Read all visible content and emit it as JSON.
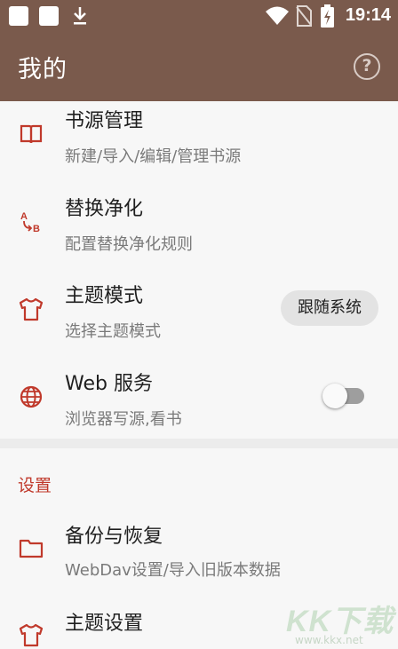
{
  "status_bar": {
    "time": "19:14",
    "icons": [
      "square-icon",
      "square-icon",
      "download-icon",
      "wifi-icon",
      "no-sim-icon",
      "battery-charging-icon"
    ]
  },
  "app_bar": {
    "title": "我的",
    "help_icon": "?"
  },
  "items": [
    {
      "title": "书源管理",
      "subtitle": "新建/导入/编辑/管理书源",
      "icon": "book-icon"
    },
    {
      "title": "替换净化",
      "subtitle": "配置替换净化规则",
      "icon": "replace-ab-icon"
    },
    {
      "title": "主题模式",
      "subtitle": "选择主题模式",
      "icon": "shirt-icon",
      "value": "跟随系统"
    },
    {
      "title": "Web 服务",
      "subtitle": "浏览器写源,看书",
      "icon": "globe-icon",
      "toggle": false
    },
    {
      "title": "备份与恢复",
      "subtitle": "WebDav设置/导入旧版本数据",
      "icon": "folder-icon"
    },
    {
      "title": "主题设置",
      "icon": "shirt-icon"
    }
  ],
  "section": {
    "title": "设置"
  },
  "watermark": {
    "text": "KK下载",
    "url": "www.kkx.net"
  },
  "colors": {
    "app_bar": "#7a5a4c",
    "accent": "#c0392b",
    "background": "#f7f7f7"
  }
}
